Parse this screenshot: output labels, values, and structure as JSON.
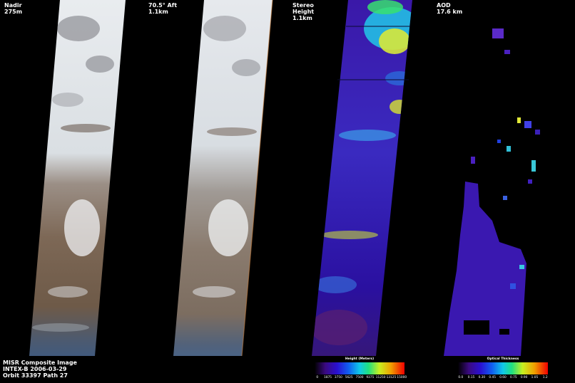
{
  "panels": [
    {
      "line1": "Nadir",
      "line2": "275m",
      "line3": ""
    },
    {
      "line1": "70.5° Aft",
      "line2": "1.1km",
      "line3": ""
    },
    {
      "line1": "Stereo",
      "line2": "Height",
      "line3": "1.1km"
    },
    {
      "line1": "AOD",
      "line2": "17.6 km",
      "line3": ""
    }
  ],
  "footer": {
    "line1": "MISR Composite Image",
    "line2": "INTEX-B  2006-03-29",
    "line3": "Orbit 33397 Path 27"
  },
  "legends": {
    "height": {
      "title": "Height (Meters)",
      "ticks": [
        "0",
        "1875",
        "3750",
        "5625",
        "7500",
        "9375",
        "11250",
        "13125",
        "15000"
      ]
    },
    "aod": {
      "title": "Optical Thickness",
      "ticks": [
        "0.0",
        "0.15",
        "0.30",
        "0.45",
        "0.60",
        "0.75",
        "0.90",
        "1.05",
        "1.2"
      ]
    }
  }
}
